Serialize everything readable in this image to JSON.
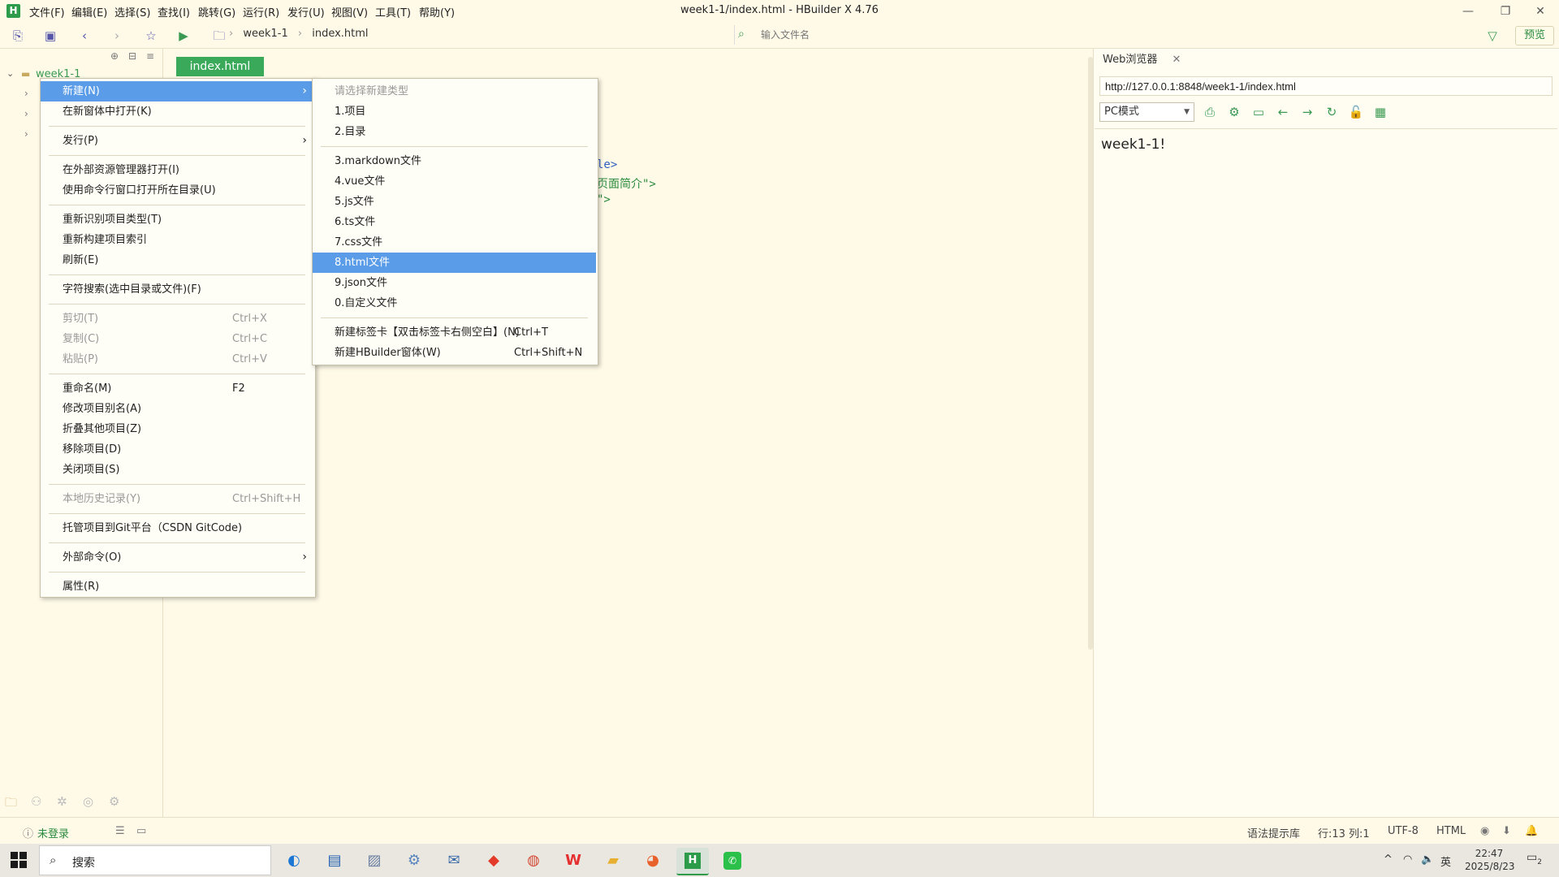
{
  "title_bar": {
    "menus": [
      "文件(F)",
      "编辑(E)",
      "选择(S)",
      "查找(I)",
      "跳转(G)",
      "运行(R)",
      "发行(U)",
      "视图(V)",
      "工具(T)",
      "帮助(Y)"
    ],
    "window_title": "week1-1/index.html - HBuilder X 4.76",
    "logo_text": "H"
  },
  "toolbar": {
    "breadcrumb": [
      "week1-1",
      "index.html"
    ],
    "file_search_placeholder": "输入文件名",
    "preview_label": "预览"
  },
  "sidebar": {
    "project_name": "week1-1"
  },
  "editor": {
    "tab_label": "index.html",
    "code_fragments": [
      "le>",
      "页面简介\">",
      "\">"
    ]
  },
  "context_menu": {
    "items": [
      {
        "label": "新建(N)",
        "shortcut": "",
        "submenu": true,
        "highlighted": true,
        "disabled": false
      },
      {
        "label": "在新窗体中打开(K)",
        "shortcut": "",
        "disabled": false
      },
      {
        "sep": true
      },
      {
        "label": "发行(P)",
        "shortcut": "",
        "submenu": true,
        "disabled": false
      },
      {
        "sep": true
      },
      {
        "label": "在外部资源管理器打开(I)",
        "shortcut": "",
        "disabled": false
      },
      {
        "label": "使用命令行窗口打开所在目录(U)",
        "shortcut": "",
        "disabled": false
      },
      {
        "sep": true
      },
      {
        "label": "重新识别项目类型(T)",
        "shortcut": "",
        "disabled": false
      },
      {
        "label": "重新构建项目索引",
        "shortcut": "",
        "disabled": false
      },
      {
        "label": "刷新(E)",
        "shortcut": "",
        "disabled": false
      },
      {
        "sep": true
      },
      {
        "label": "字符搜索(选中目录或文件)(F)",
        "shortcut": "",
        "disabled": false
      },
      {
        "sep": true
      },
      {
        "label": "剪切(T)",
        "shortcut": "Ctrl+X",
        "disabled": true
      },
      {
        "label": "复制(C)",
        "shortcut": "Ctrl+C",
        "disabled": true
      },
      {
        "label": "粘贴(P)",
        "shortcut": "Ctrl+V",
        "disabled": true
      },
      {
        "sep": true
      },
      {
        "label": "重命名(M)",
        "shortcut": "F2",
        "disabled": false
      },
      {
        "label": "修改项目别名(A)",
        "shortcut": "",
        "disabled": false
      },
      {
        "label": "折叠其他项目(Z)",
        "shortcut": "",
        "disabled": false
      },
      {
        "label": "移除项目(D)",
        "shortcut": "",
        "disabled": false
      },
      {
        "label": "关闭项目(S)",
        "shortcut": "",
        "disabled": false
      },
      {
        "sep": true
      },
      {
        "label": "本地历史记录(Y)",
        "shortcut": "Ctrl+Shift+H",
        "disabled": true
      },
      {
        "sep": true
      },
      {
        "label": "托管项目到Git平台（CSDN GitCode)",
        "shortcut": "",
        "disabled": false
      },
      {
        "sep": true
      },
      {
        "label": "外部命令(O)",
        "shortcut": "",
        "submenu": true,
        "disabled": false
      },
      {
        "sep": true
      },
      {
        "label": "属性(R)",
        "shortcut": "",
        "disabled": false
      }
    ]
  },
  "submenu": {
    "items": [
      {
        "label": "请选择新建类型",
        "shortcut": "",
        "disabled": true
      },
      {
        "label": "1.项目",
        "shortcut": ""
      },
      {
        "label": "2.目录",
        "shortcut": ""
      },
      {
        "sep": true
      },
      {
        "label": "3.markdown文件",
        "shortcut": ""
      },
      {
        "label": "4.vue文件",
        "shortcut": ""
      },
      {
        "label": "5.js文件",
        "shortcut": ""
      },
      {
        "label": "6.ts文件",
        "shortcut": ""
      },
      {
        "label": "7.css文件",
        "shortcut": ""
      },
      {
        "label": "8.html文件",
        "shortcut": "",
        "highlighted": true
      },
      {
        "label": "9.json文件",
        "shortcut": ""
      },
      {
        "label": "0.自定义文件",
        "shortcut": ""
      },
      {
        "sep": true
      },
      {
        "label": "新建标签卡【双击标签卡右侧空白】(N)",
        "shortcut": "Ctrl+T"
      },
      {
        "label": "新建HBuilder窗体(W)",
        "shortcut": "Ctrl+Shift+N"
      }
    ]
  },
  "browser": {
    "tab_label": "Web浏览器",
    "url": "http://127.0.0.1:8848/week1-1/index.html",
    "mode": "PC模式",
    "page_text": "week1-1!"
  },
  "status_bar": {
    "login": "未登录",
    "syntax_lib": "语法提示库",
    "position": "行:13  列:1",
    "encoding": "UTF-8",
    "language": "HTML"
  },
  "taskbar": {
    "search_placeholder": "搜索",
    "time": "22:47",
    "date": "2025/8/23",
    "ime": "英",
    "notifications": "2"
  }
}
